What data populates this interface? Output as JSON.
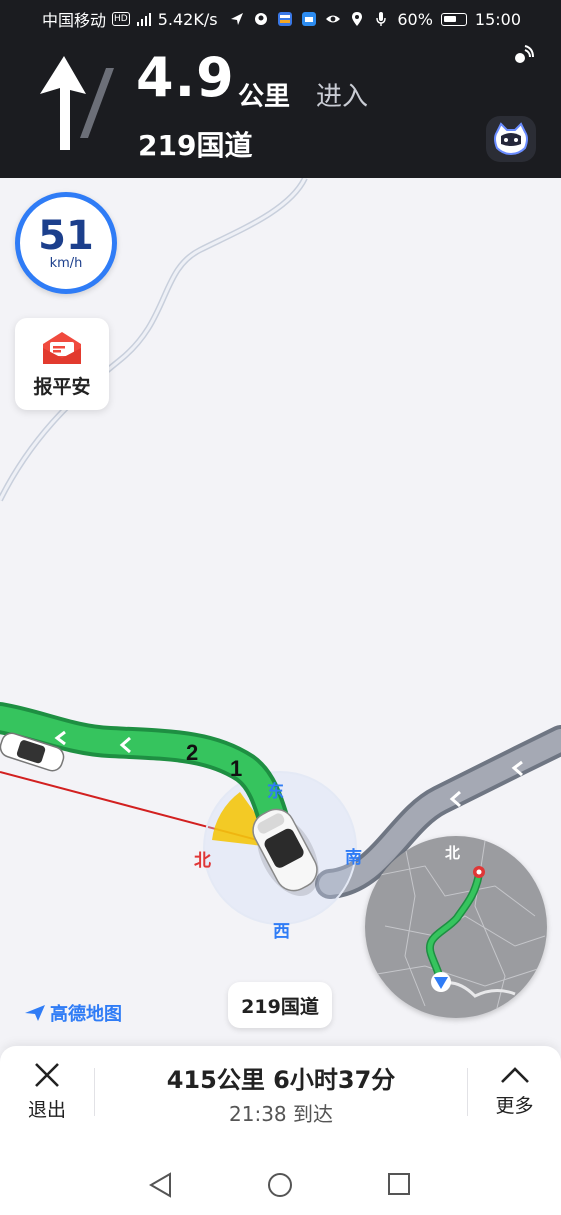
{
  "status_bar": {
    "carrier": "中国移动",
    "hd": "HD",
    "net_speed": "5.42K/s",
    "battery": "60%",
    "time": "15:00"
  },
  "nav": {
    "distance": "4.9",
    "distance_unit": "公里",
    "action": "进入",
    "road_name": "219国道"
  },
  "speed": {
    "value": "51",
    "unit": "km/h"
  },
  "safe_button": {
    "label": "报平安"
  },
  "compass": {
    "north": "北",
    "east": "东",
    "south": "南",
    "west": "西"
  },
  "lane_numbers": [
    "2",
    "1"
  ],
  "minimap": {
    "north": "北"
  },
  "brand": "高德地图",
  "road_chip": "219国道",
  "bottom": {
    "exit_label": "退出",
    "trip_summary": "415公里  6小时37分",
    "arrival": "21:38 到达",
    "more_label": "更多"
  },
  "colors": {
    "route": "#36c45e",
    "passed_route": "#a5a9b4",
    "accent": "#2f7cf6",
    "north": "#e03636"
  }
}
